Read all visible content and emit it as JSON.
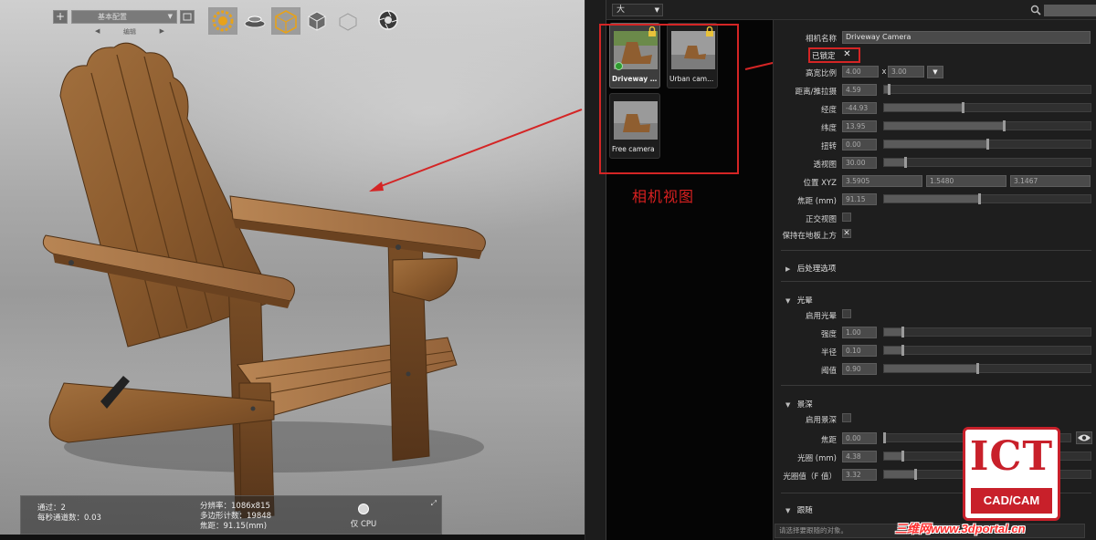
{
  "viewport": {
    "toolbar": {
      "add_label": "+",
      "preset": "基本配置",
      "sub_prev": "◀",
      "sub_label": "编辑",
      "sub_next": "▶"
    },
    "info": {
      "passes": "通过：2",
      "samples_per_sec": "每秒通道数：0.03",
      "resolution": "分辨率：1086x815",
      "triangles": "多边形计数：19848",
      "focal": "焦距：91.15(mm)",
      "cpu_only": "仅 CPU",
      "pin_glyph": "⤢"
    }
  },
  "camera_list": {
    "size_select": "大",
    "cameras": [
      {
        "label": "Driveway C...",
        "active": true,
        "locked": true
      },
      {
        "label": "Urban cam...",
        "active": false,
        "locked": true
      },
      {
        "label": "Free camera",
        "active": false,
        "locked": false
      }
    ],
    "annotation": "相机视图"
  },
  "properties": {
    "camera_name_label": "相机名称",
    "camera_name": "Driveway Camera",
    "locked_label": "已锁定",
    "locked_glyph": "✕",
    "aspect_label": "高宽比例",
    "aspect_w": "4.00",
    "aspect_x": "x",
    "aspect_h": "3.00",
    "dropdown_glyph": "▼",
    "sliders": [
      {
        "label": "距离/推拉摄",
        "value": "4.59",
        "fraction": 0.02
      },
      {
        "label": "经度",
        "value": "-44.93",
        "fraction": 0.38
      },
      {
        "label": "纬度",
        "value": "13.95",
        "fraction": 0.58
      },
      {
        "label": "扭转",
        "value": "0.00",
        "fraction": 0.5
      },
      {
        "label": "透视图",
        "value": "30.00",
        "fraction": 0.1
      }
    ],
    "position_label": "位置 XYZ",
    "position": [
      "3.5905",
      "1.5480",
      "3.1467"
    ],
    "focal_label": "焦距 (mm)",
    "focal_value": "91.15",
    "focal_fraction": 0.46,
    "ortho_label": "正交视图",
    "keep_above_label": "保持在地板上方",
    "keep_above_glyph": "✕",
    "section_post": "后处理选项",
    "section_bloom": "光晕",
    "bloom_enable": "启用光晕",
    "bloom_sliders": [
      {
        "label": "强度",
        "value": "1.00",
        "fraction": 0.09
      },
      {
        "label": "半径",
        "value": "0.10",
        "fraction": 0.09
      },
      {
        "label": "阈值",
        "value": "0.90",
        "fraction": 0.45
      }
    ],
    "section_dof": "景深",
    "dof_enable": "启用景深",
    "dof_sliders": [
      {
        "label": "焦距",
        "value": "0.00",
        "fraction": 0.0
      },
      {
        "label": "光圈 (mm)",
        "value": "4.38",
        "fraction": 0.09
      },
      {
        "label": "光圈值（F 值）",
        "value": "3.32",
        "fraction": 0.15
      }
    ],
    "section_track": "跟随",
    "track_placeholder": "请选择要跟随的对象。",
    "section_triangle_open": "▼",
    "section_triangle_closed": "▶"
  },
  "watermark": {
    "logo_top": "ICT",
    "logo_bottom": "CAD/CAM",
    "site": "三维网www.3dportal.cn"
  },
  "colors": {
    "annotation_red": "#d42525",
    "panel_bg": "#1e1e1e",
    "field_bg": "#4a4a4a",
    "logo_red": "#c8202a"
  }
}
